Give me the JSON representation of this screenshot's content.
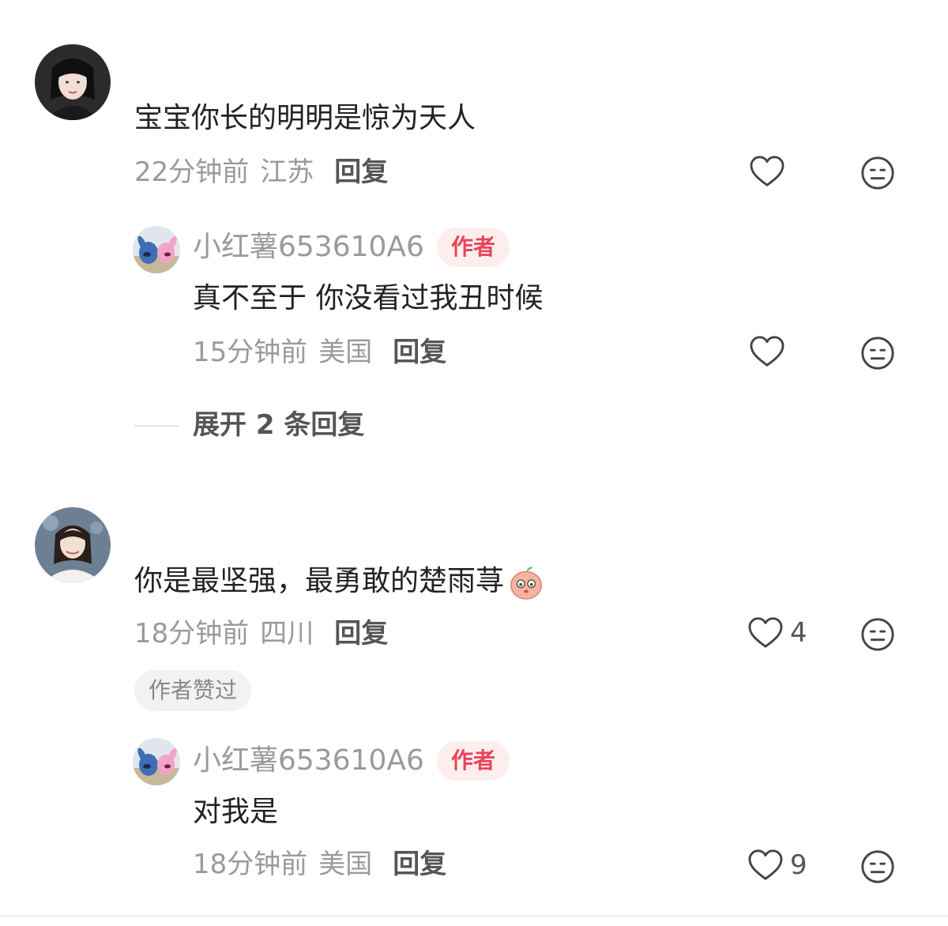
{
  "comments": [
    {
      "text": "宝宝你长的明明是惊为天人",
      "time": "22分钟前",
      "location": "江苏",
      "reply_label": "回复",
      "likes": "",
      "replies": [
        {
          "username": "小红薯653610A6",
          "badge": "作者",
          "text": "真不至于 你没看过我丑时候",
          "time": "15分钟前",
          "location": "美国",
          "reply_label": "回复",
          "likes": ""
        }
      ],
      "expand_label": "展开 2 条回复"
    },
    {
      "text": "你是最坚强，最勇敢的楚雨荨",
      "emoji": "peach-face-emoji",
      "time": "18分钟前",
      "location": "四川",
      "reply_label": "回复",
      "likes": "4",
      "liked_by_author": "作者赞过",
      "replies": [
        {
          "username": "小红薯653610A6",
          "badge": "作者",
          "text": "对我是",
          "time": "18分钟前",
          "location": "美国",
          "reply_label": "回复",
          "likes": "9"
        }
      ]
    }
  ],
  "colors": {
    "badge_text": "#e8455a",
    "badge_bg": "#fdeeee",
    "meta": "#9a9a9a"
  },
  "icons": [
    "heart-outline-icon",
    "neutral-face-icon"
  ]
}
